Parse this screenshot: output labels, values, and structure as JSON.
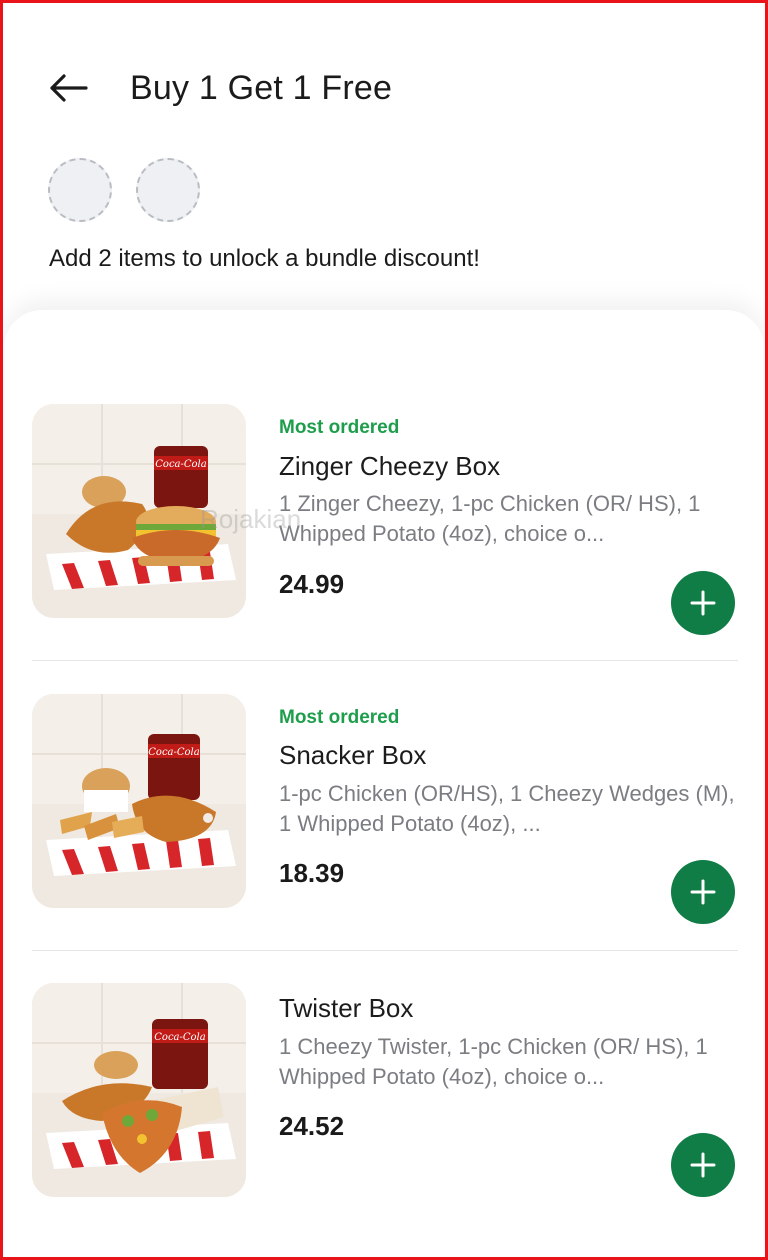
{
  "header": {
    "title": "Buy 1 Get 1 Free",
    "back_icon": "arrow-left-icon"
  },
  "bundle": {
    "slots_total": 2,
    "message": "Add 2 items to unlock a bundle discount!"
  },
  "items": [
    {
      "tag": "Most ordered",
      "name": "Zinger Cheezy Box",
      "description": "1 Zinger Cheezy, 1-pc Chicken (OR/ HS), 1 Whipped Potato (4oz), choice o...",
      "price": "24.99",
      "image": "zinger-cheezy-box-image"
    },
    {
      "tag": "Most ordered",
      "name": "Snacker Box",
      "description": "1-pc Chicken (OR/HS), 1 Cheezy Wedges (M), 1 Whipped Potato (4oz), ...",
      "price": "18.39",
      "image": "snacker-box-image"
    },
    {
      "tag": "",
      "name": "Twister Box",
      "description": "1 Cheezy Twister, 1-pc Chicken (OR/ HS), 1 Whipped Potato (4oz), choice o...",
      "price": "24.52",
      "image": "twister-box-image"
    }
  ],
  "watermark": "Rojakian",
  "colors": {
    "accent_green": "#0f7d45",
    "tag_green": "#1e9e4c",
    "frame_red": "#e8141a"
  }
}
